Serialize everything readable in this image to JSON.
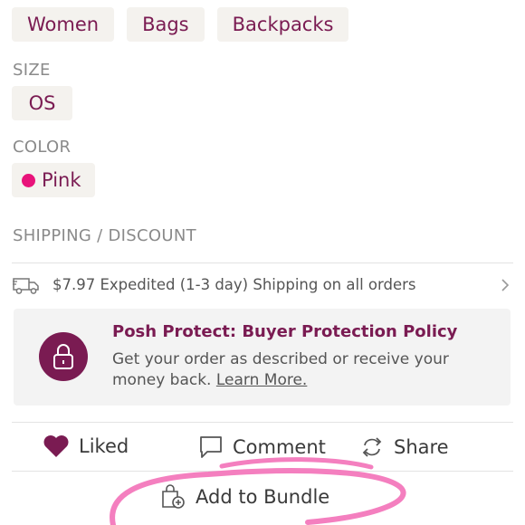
{
  "categories": [
    "Women",
    "Bags",
    "Backpacks"
  ],
  "size": {
    "label": "SIZE",
    "value": "OS"
  },
  "color": {
    "label": "COLOR",
    "value": "Pink",
    "swatch": "#e8137a"
  },
  "shipping": {
    "label": "SHIPPING / DISCOUNT",
    "text": "$7.97 Expedited (1-3 day) Shipping on all orders",
    "icon": "truck-icon"
  },
  "protect": {
    "title": "Posh Protect: Buyer Protection Policy",
    "desc": "Get your order as described or receive your money back.",
    "link": "Learn More.",
    "icon": "lock-icon"
  },
  "actions": {
    "like": "Liked",
    "comment": "Comment",
    "share": "Share"
  },
  "bundle": {
    "label": "Add to Bundle"
  },
  "colors": {
    "brand": "#7a1b52",
    "chip_bg": "#f4f2ee",
    "annotation": "#f47fbf"
  }
}
